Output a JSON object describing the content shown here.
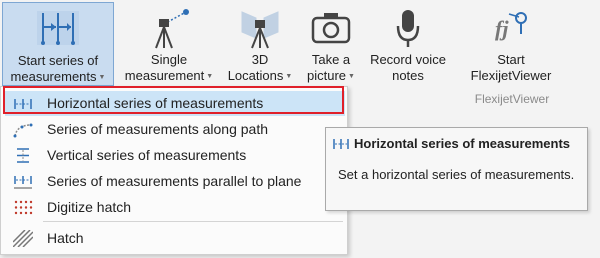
{
  "ribbon": {
    "buttons": [
      {
        "line1": "Start series of",
        "line2": "measurements",
        "icon": "series-measure-icon",
        "dropdown": true
      },
      {
        "line1": "Single",
        "line2": "measurement",
        "icon": "total-station-icon",
        "dropdown": true
      },
      {
        "line1": "3D",
        "line2": "Locations",
        "icon": "3d-locations-icon",
        "dropdown": true
      },
      {
        "line1": "Take a",
        "line2": "picture",
        "icon": "camera-icon",
        "dropdown": true
      },
      {
        "line1": "Record voice",
        "line2": "notes",
        "icon": "microphone-icon",
        "dropdown": false
      },
      {
        "line1": "Start",
        "line2": "FlexijetViewer",
        "icon": "flexijet-viewer-icon",
        "dropdown": false
      }
    ],
    "group_label": "FlexijetViewer"
  },
  "menu": {
    "items": [
      {
        "label": "Horizontal series of measurements",
        "icon": "horizontal-series-icon"
      },
      {
        "label": "Series of measurements along path",
        "icon": "path-series-icon"
      },
      {
        "label": "Vertical series of measurements",
        "icon": "vertical-series-icon"
      },
      {
        "label": "Series of measurements parallel to plane",
        "icon": "parallel-plane-icon"
      },
      {
        "label": "Digitize hatch",
        "icon": "digitize-hatch-icon"
      },
      {
        "label": "Hatch",
        "icon": "hatch-icon"
      }
    ]
  },
  "tooltip": {
    "title": "Horizontal series of measurements",
    "body": "Set a horizontal series of measurements."
  },
  "colors": {
    "accent_blue": "#2f6fb5",
    "highlight_border": "#e0202a",
    "selected_bg": "#cce4f7"
  }
}
